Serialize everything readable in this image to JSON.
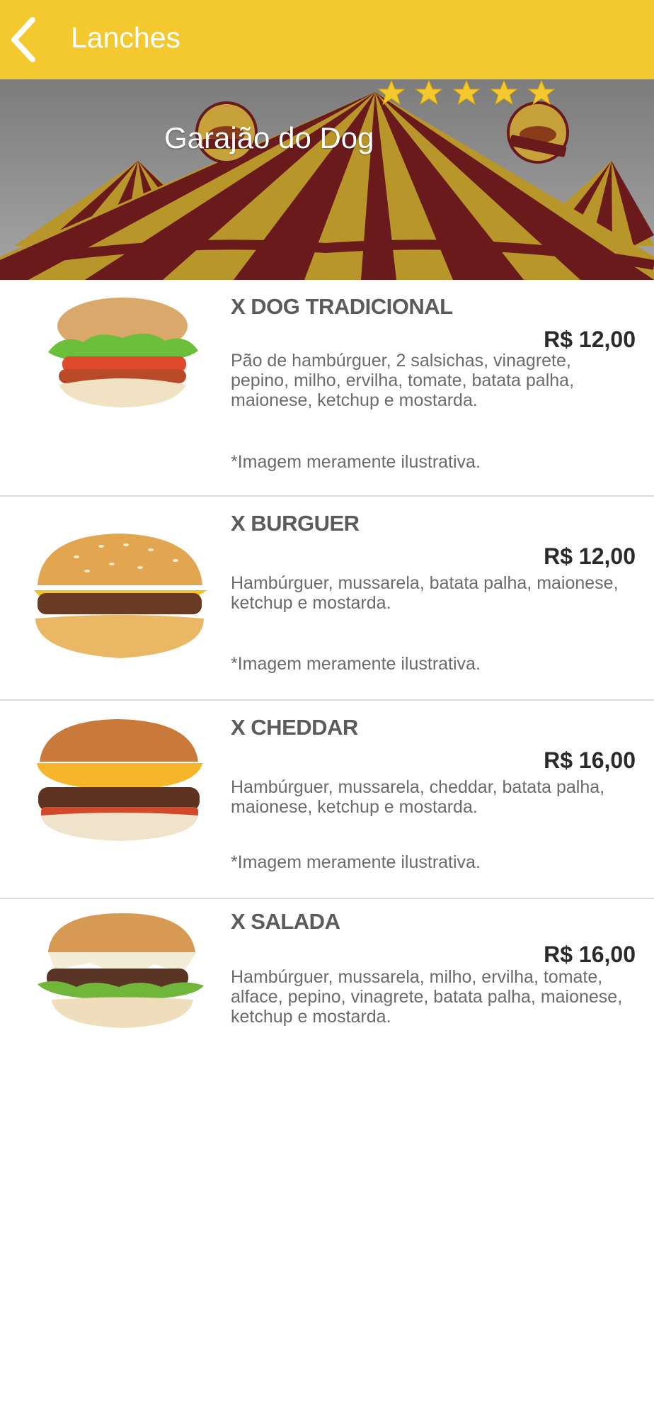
{
  "header": {
    "title": "Lanches",
    "back_icon": "chevron-left-icon"
  },
  "store": {
    "name": "Garajão do Dog",
    "rating": 5
  },
  "items": [
    {
      "name": "X DOG TRADICIONAL",
      "price": "R$ 12,00",
      "description": "Pão de hambúrguer, 2 salsichas, vinagrete, pepino, milho, ervilha, tomate, batata palha, maionese, ketchup e mostarda.",
      "note": "*Imagem meramente ilustrativa."
    },
    {
      "name": "X BURGUER",
      "price": "R$ 12,00",
      "description": "Hambúrguer, mussarela, batata palha, maionese, ketchup e mostarda.",
      "note": "*Imagem meramente ilustrativa."
    },
    {
      "name": "X CHEDDAR",
      "price": "R$ 16,00",
      "description": "Hambúrguer, mussarela, cheddar, batata palha, maionese, ketchup e mostarda.",
      "note": "*Imagem meramente ilustrativa."
    },
    {
      "name": "X SALADA",
      "price": "R$ 16,00",
      "description": "Hambúrguer, mussarela, milho, ervilha, tomate, alface, pepino, vinagrete, batata palha, maionese, ketchup e mostarda.",
      "note": ""
    }
  ],
  "colors": {
    "accent": "#f4c92f",
    "tent_red": "#6b1a1c",
    "tent_gold": "#b9962a"
  }
}
